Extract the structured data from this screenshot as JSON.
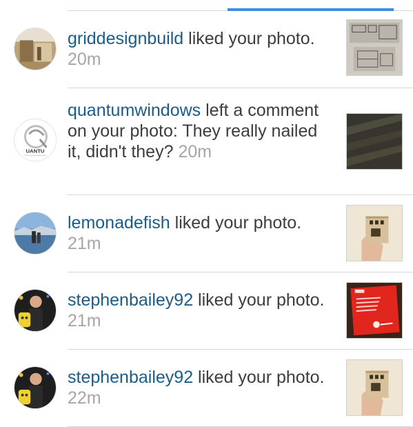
{
  "notifications": [
    {
      "username": "griddesignbuild",
      "action": " liked your photo.",
      "time": "20m",
      "avatar_icon": "griddesignbuild-avatar",
      "thumb_icon": "floor-plan-photo"
    },
    {
      "username": "quantumwindows",
      "action": " left a comment on your photo: They really nailed it, didn't they?",
      "time": "20m",
      "avatar_icon": "quantum-logo-avatar",
      "avatar_text": "UANTU",
      "thumb_icon": "dark-texture-photo"
    },
    {
      "username": "lemonadefish",
      "action": " liked your photo.",
      "time": "21m",
      "avatar_icon": "lake-landscape-avatar",
      "thumb_icon": "model-house-photo"
    },
    {
      "username": "stephenbailey92",
      "action": " liked your photo.",
      "time": "21m",
      "avatar_icon": "person-avatar",
      "thumb_icon": "red-booklet-photo"
    },
    {
      "username": "stephenbailey92",
      "action": " liked your photo.",
      "time": "22m",
      "avatar_icon": "person-avatar",
      "thumb_icon": "model-house-photo"
    }
  ],
  "colors": {
    "username": "#1a5c8c",
    "text": "#3d3d3d",
    "time": "#a6a6a6",
    "tab_indicator": "#3d8edd",
    "divider": "#d6d6d6"
  }
}
